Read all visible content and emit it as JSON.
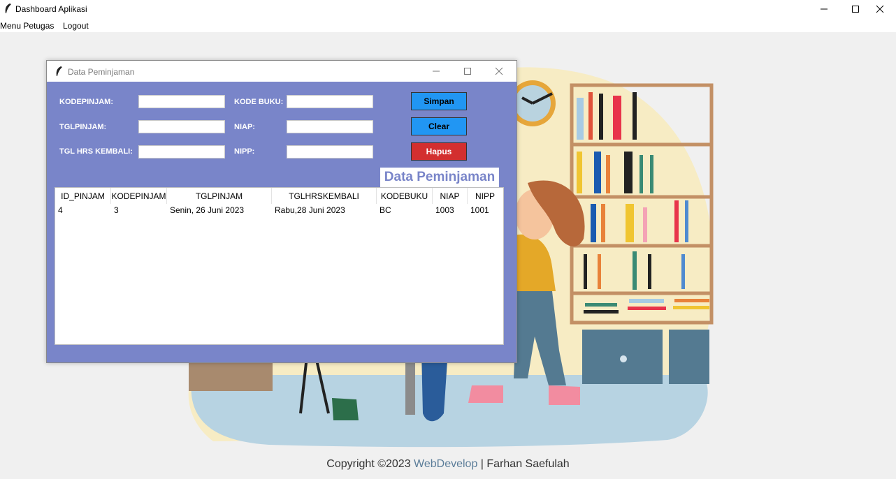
{
  "window": {
    "title": "Dashboard Aplikasi"
  },
  "menu": [
    "Menu Petugas",
    "Logout"
  ],
  "dialog": {
    "title": "Data Peminjaman",
    "fields": {
      "kodepinjam": {
        "label": "KODEPINJAM:",
        "value": ""
      },
      "tglpinjam": {
        "label": "TGLPINJAM:",
        "value": ""
      },
      "tglhrskembali": {
        "label": "TGL HRS KEMBALI:",
        "value": ""
      },
      "kodebuku": {
        "label": "KODE BUKU:",
        "value": ""
      },
      "niap": {
        "label": "NIAP:",
        "value": ""
      },
      "nipp": {
        "label": "NIPP:",
        "value": ""
      }
    },
    "buttons": {
      "simpan": "Simpan",
      "clear": "Clear",
      "hapus": "Hapus"
    },
    "heading": "Data Peminjaman",
    "table": {
      "columns": [
        "ID_PINJAM",
        "KODEPINJAM",
        "TGLPINJAM",
        "TGLHRSKEMBALI",
        "KODEBUKU",
        "NIAP",
        "NIPP"
      ],
      "rows": [
        [
          "4",
          "3",
          "Senin, 26 Juni 2023",
          "Rabu,28 Juni 2023",
          "BC",
          "1003",
          "1001"
        ]
      ]
    }
  },
  "footer": {
    "prefix": "Copyright ©2023 ",
    "link": "WebDevelop",
    "suffix": " | Farhan Saefulah"
  },
  "colors": {
    "dialog_bg": "#7985c9",
    "simpan": "#2196f3",
    "clear": "#2196f3",
    "hapus": "#d32f2f"
  }
}
